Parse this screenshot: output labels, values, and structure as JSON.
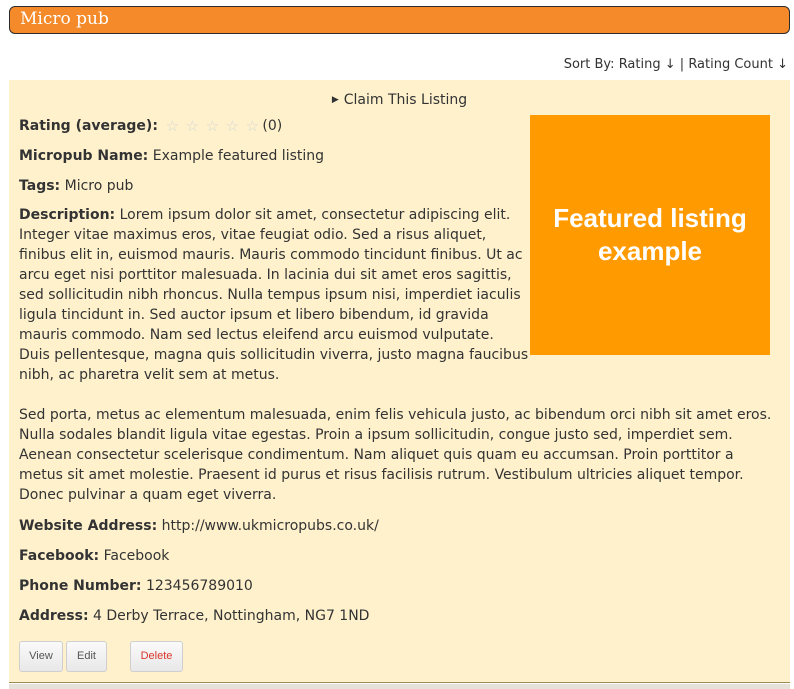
{
  "header": {
    "title": "Micro pub"
  },
  "sort": {
    "prefix": "Sort By:",
    "rating_label": "Rating ↓",
    "separator": "|",
    "rating_count_label": "Rating Count ↓"
  },
  "listing": {
    "claim_label": "Claim This Listing",
    "feature_image_text": "Featured listing example",
    "rating": {
      "label": "Rating (average):",
      "stars": 5,
      "filled": 0,
      "count": "(0)"
    },
    "name": {
      "label": "Micropub Name:",
      "value": "Example featured listing"
    },
    "tags": {
      "label": "Tags:",
      "value": "Micro pub"
    },
    "description": {
      "label": "Description:",
      "paragraph1": "Lorem ipsum dolor sit amet, consectetur adipiscing elit. Integer vitae maximus eros, vitae feugiat odio. Sed a risus aliquet, finibus elit in, euismod mauris. Mauris commodo tincidunt finibus. Ut ac arcu eget nisi porttitor malesuada. In lacinia dui sit amet eros sagittis, sed sollicitudin nibh rhoncus. Nulla tempus ipsum nisi, imperdiet iaculis ligula tincidunt in. Sed auctor ipsum et libero bibendum, id gravida mauris commodo. Nam sed lectus eleifend arcu euismod vulputate. Duis pellentesque, magna quis sollicitudin viverra, justo magna faucibus nibh, ac pharetra velit sem at metus.",
      "paragraph2": "Sed porta, metus ac elementum malesuada, enim felis vehicula justo, ac bibendum orci nibh sit amet eros. Nulla sodales blandit ligula vitae egestas. Proin a ipsum sollicitudin, congue justo sed, imperdiet sem. Aenean consectetur scelerisque condimentum. Nam aliquet quis quam eu accumsan. Proin porttitor a metus sit amet molestie. Praesent id purus et risus facilisis rutrum. Vestibulum ultricies aliquet tempor. Donec pulvinar a quam eget viverra."
    },
    "website": {
      "label": "Website Address:",
      "value": "http://www.ukmicropubs.co.uk/"
    },
    "facebook": {
      "label": "Facebook:",
      "value": "Facebook"
    },
    "phone": {
      "label": "Phone Number:",
      "value": "123456789010"
    },
    "address": {
      "label": "Address:",
      "value": "4 Derby Terrace, Nottingham, NG7 1ND"
    },
    "actions": {
      "view": "View",
      "edit": "Edit",
      "delete": "Delete"
    }
  },
  "colors": {
    "header_bg": "#f58a2a",
    "listing_bg": "#fef1cc",
    "feature_bg": "#ff9a00",
    "delete_text": "#d9362b"
  }
}
